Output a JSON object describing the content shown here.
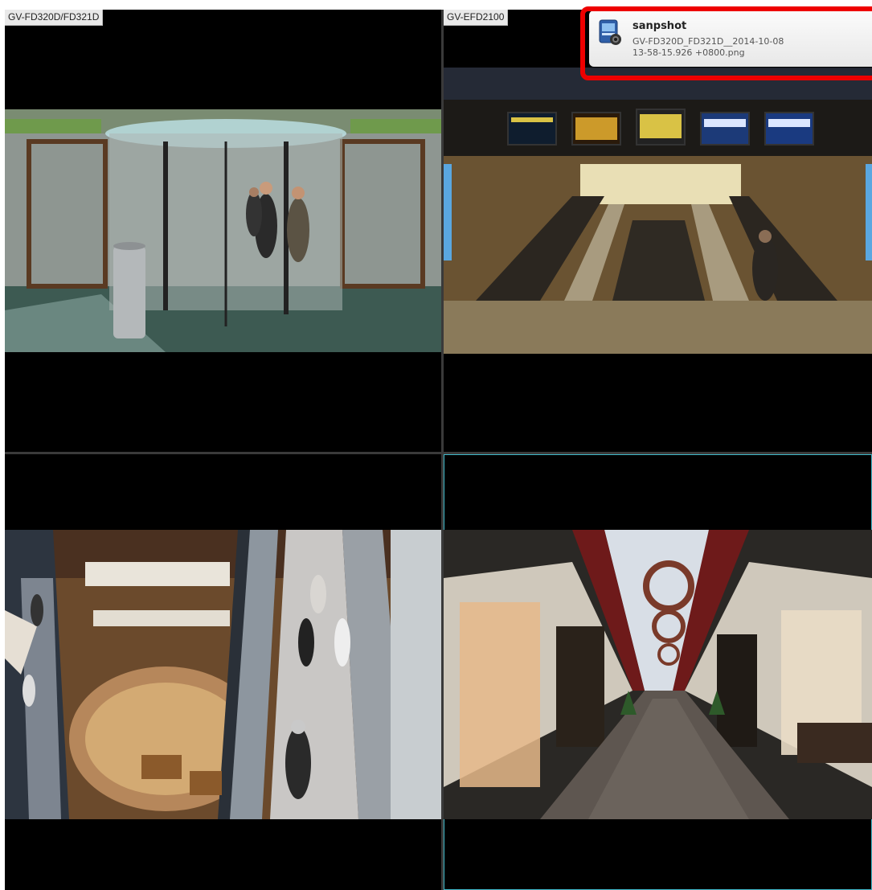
{
  "cameras": [
    {
      "label": "GV-FD320D/FD321D",
      "scene": "revolving-door-lobby"
    },
    {
      "label": "GV-EFD2100",
      "scene": "subway-escalators"
    },
    {
      "label": "",
      "scene": "mall-atrium-escalators"
    },
    {
      "label": "",
      "scene": "shopping-arcade"
    }
  ],
  "notification": {
    "title": "sanpshot",
    "line1": "GV-FD320D_FD321D__2014-10-08",
    "line2": "13-58-15.926 +0800.png",
    "icon": "snapshot-file-icon"
  },
  "colors": {
    "highlight_frame": "#ee0000",
    "selected_cell_border": "#3fb7c8"
  }
}
